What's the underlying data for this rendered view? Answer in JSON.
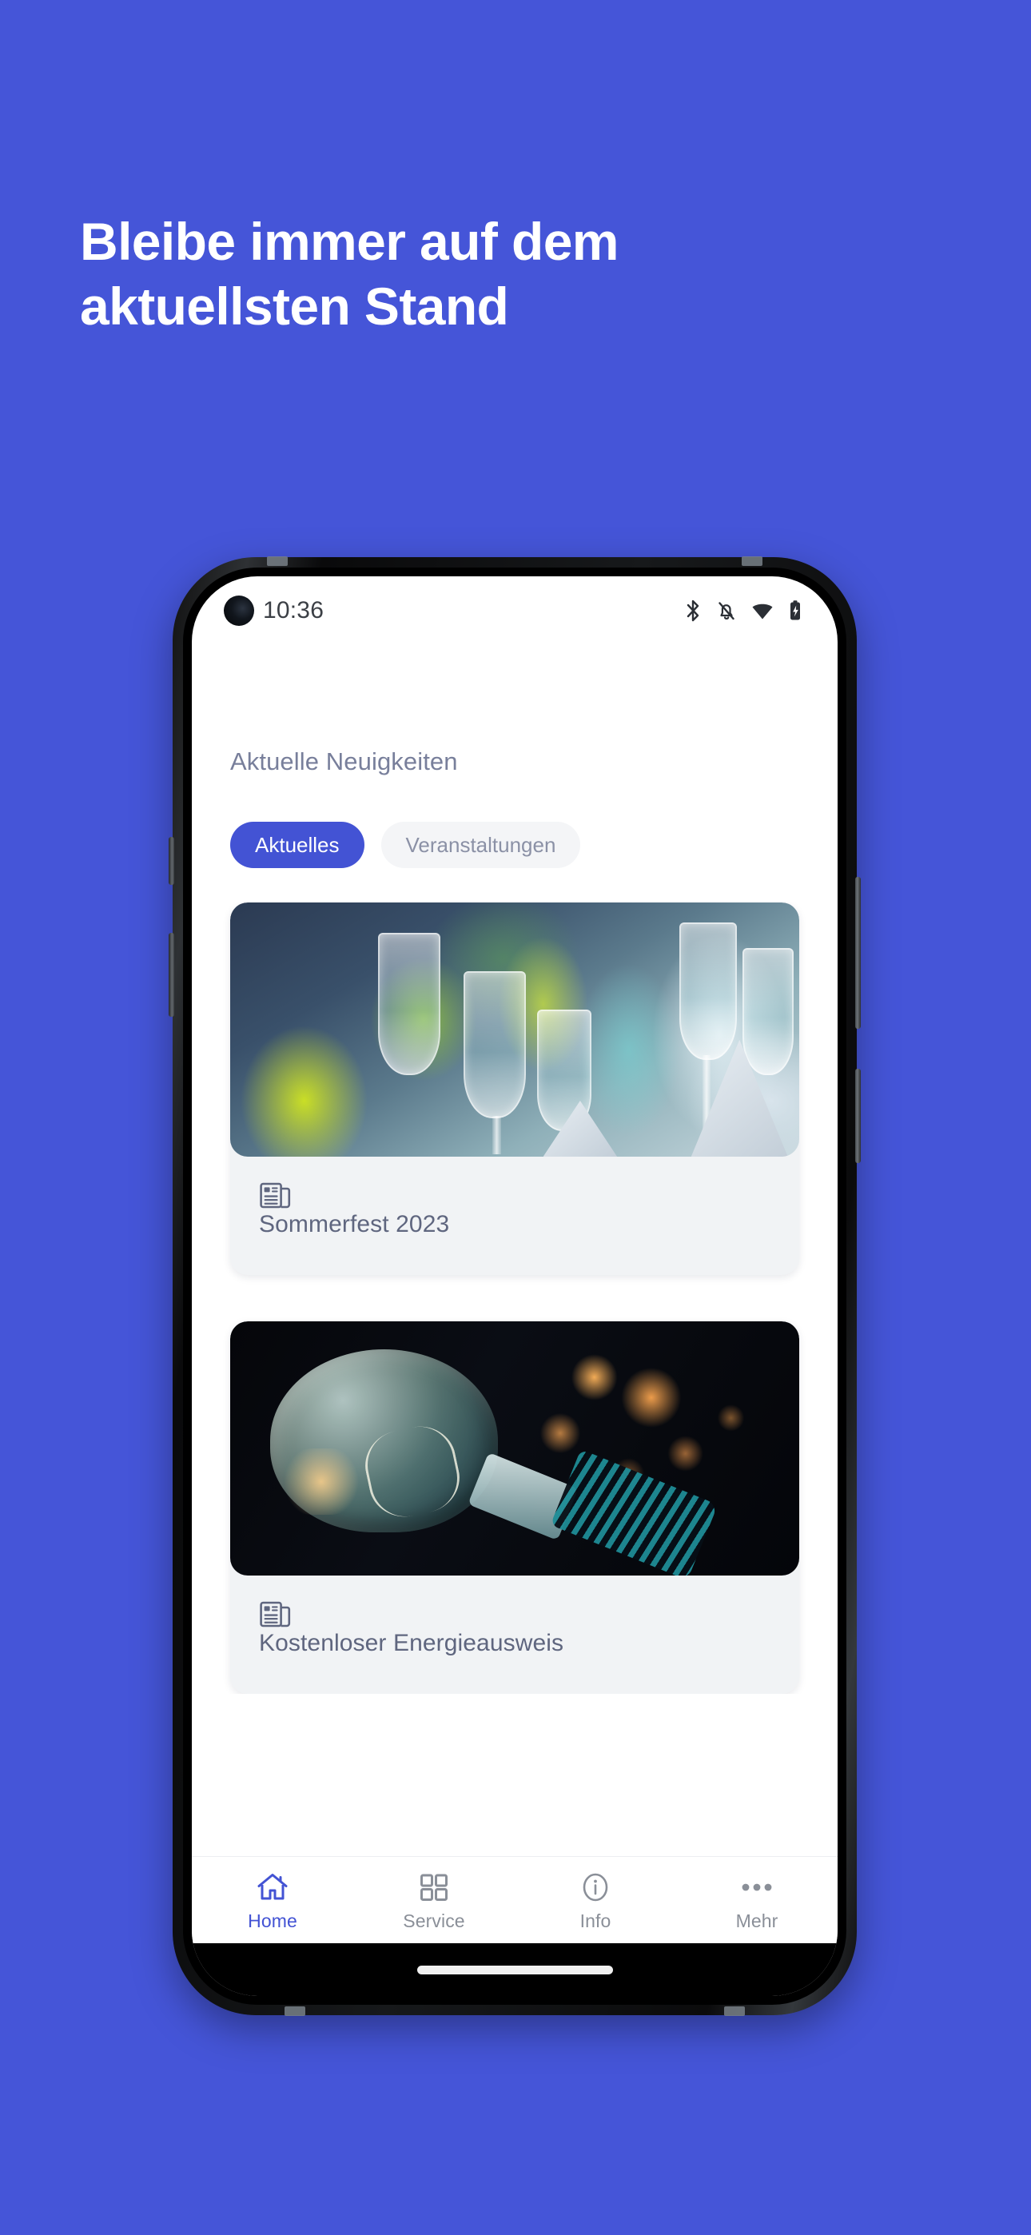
{
  "promo": {
    "headline_line1": "Bleibe immer auf dem",
    "headline_line2": "aktuellsten Stand",
    "background_color": "#4555d8",
    "headline_color": "#ffffff"
  },
  "phone": {
    "status_bar": {
      "time": "10:36",
      "icons": [
        "bluetooth-icon",
        "notifications-muted-icon",
        "wifi-icon",
        "battery-charging-icon"
      ]
    },
    "home_indicator": "home-indicator-bar"
  },
  "app": {
    "section_title": "Aktuelle Neuigkeiten",
    "accent_color": "#4353d4",
    "tabs": [
      {
        "label": "Aktuelles",
        "active": true
      },
      {
        "label": "Veranstaltungen",
        "active": false
      }
    ],
    "cards": [
      {
        "title": "Sommerfest 2023",
        "icon": "newspaper-icon",
        "image_alt": "festlich gedeckter Tisch mit Glaesern und Blumen"
      },
      {
        "title": "Kostenloser Energieausweis",
        "icon": "newspaper-icon",
        "image_alt": "Gluehbirne vor orangefarbenen Bokeh-Lichtern"
      }
    ],
    "bottom_nav": [
      {
        "label": "Home",
        "icon": "home-icon",
        "active": true
      },
      {
        "label": "Service",
        "icon": "grid-icon",
        "active": false
      },
      {
        "label": "Info",
        "icon": "info-icon",
        "active": false
      },
      {
        "label": "Mehr",
        "icon": "more-dots-icon",
        "active": false
      }
    ]
  }
}
